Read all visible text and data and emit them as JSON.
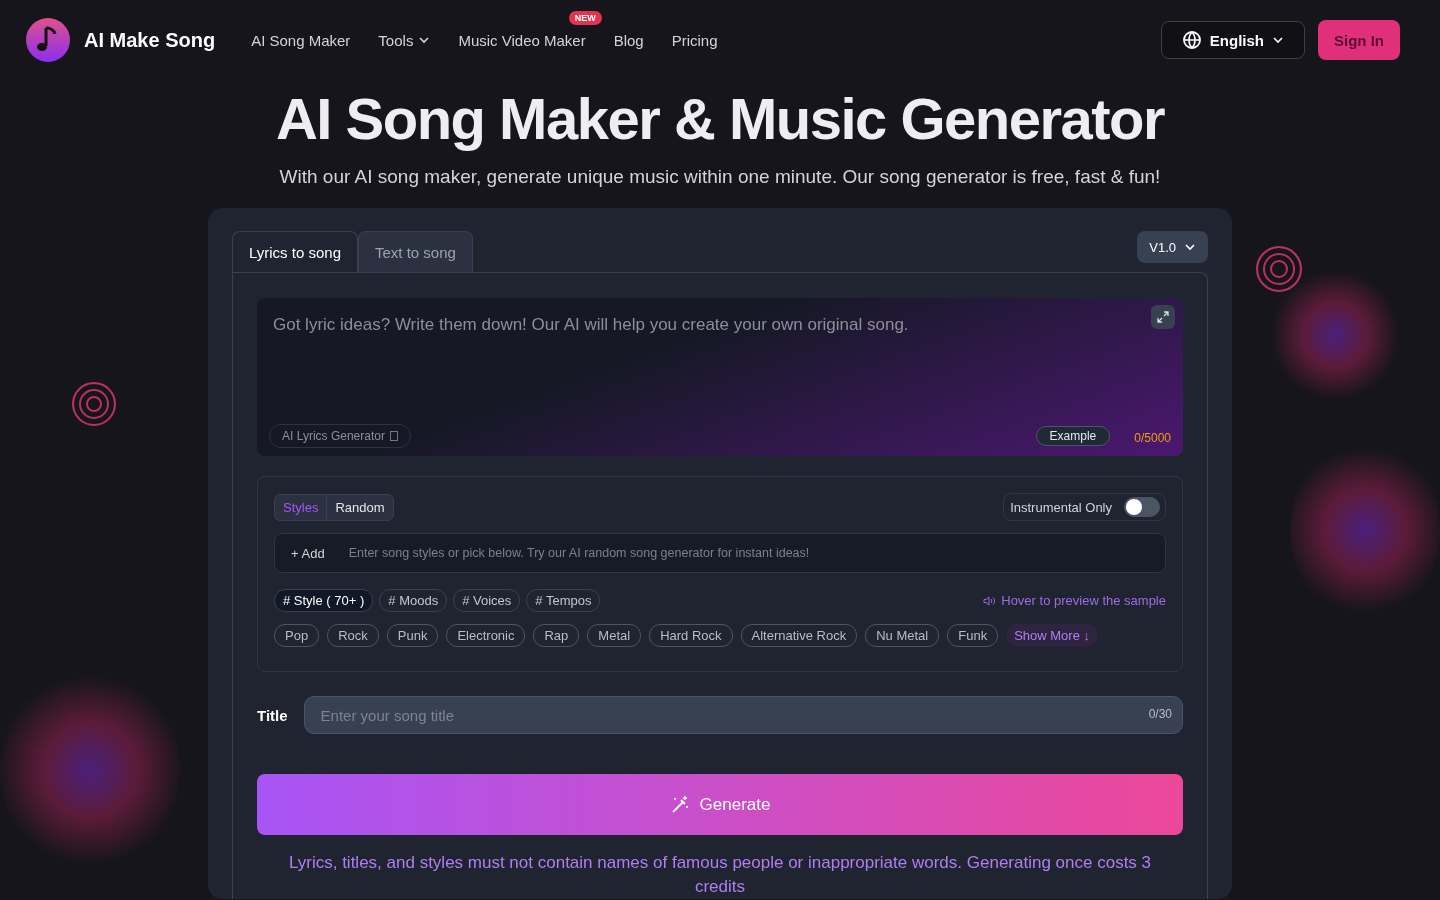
{
  "header": {
    "logo_text": "AI Make Song",
    "nav": [
      {
        "label": "AI Song Maker",
        "kind": "link"
      },
      {
        "label": "Tools",
        "kind": "dropdown"
      },
      {
        "label": "Music Video Maker",
        "kind": "link",
        "badge": "NEW"
      },
      {
        "label": "Blog",
        "kind": "link"
      },
      {
        "label": "Pricing",
        "kind": "link"
      }
    ],
    "language": "English",
    "sign_in": "Sign In"
  },
  "hero": {
    "title": "AI Song Maker & Music Generator",
    "subtitle": "With our AI song maker, generate unique music within one minute. Our song generator is free, fast & fun!"
  },
  "generator": {
    "tabs": [
      {
        "label": "Lyrics to song",
        "selected": true
      },
      {
        "label": "Text to song",
        "selected": false
      }
    ],
    "version": "V1.0",
    "lyrics": {
      "placeholder": "Got lyric ideas? Write them down! Our AI will help you create your own original song.",
      "ai_button": "AI Lyrics Generator",
      "example": "Example",
      "counter": "0/5000"
    },
    "style_modes": [
      {
        "label": "Styles",
        "selected": true
      },
      {
        "label": "Random",
        "selected": false
      }
    ],
    "instrumental": {
      "label": "Instrumental Only",
      "on": false
    },
    "style_input": {
      "add": "+ Add",
      "placeholder": "Enter song styles or pick below. Try our AI random song generator for instant ideas!"
    },
    "categories": [
      {
        "label": "# Style ( 70+ )",
        "selected": true
      },
      {
        "label": "# Moods",
        "selected": false
      },
      {
        "label": "# Voices",
        "selected": false
      },
      {
        "label": "# Tempos",
        "selected": false
      }
    ],
    "preview_hint": "Hover to preview the sample",
    "tags": [
      "Pop",
      "Rock",
      "Punk",
      "Electronic",
      "Rap",
      "Metal",
      "Hard Rock",
      "Alternative Rock",
      "Nu Metal",
      "Funk"
    ],
    "show_more": "Show More ↓",
    "title_field": {
      "label": "Title",
      "placeholder": "Enter your song title",
      "counter": "0/30"
    },
    "generate": "Generate",
    "notice": "Lyrics, titles, and styles must not contain names of famous people or inappropriate words. Generating once costs 3 credits"
  }
}
